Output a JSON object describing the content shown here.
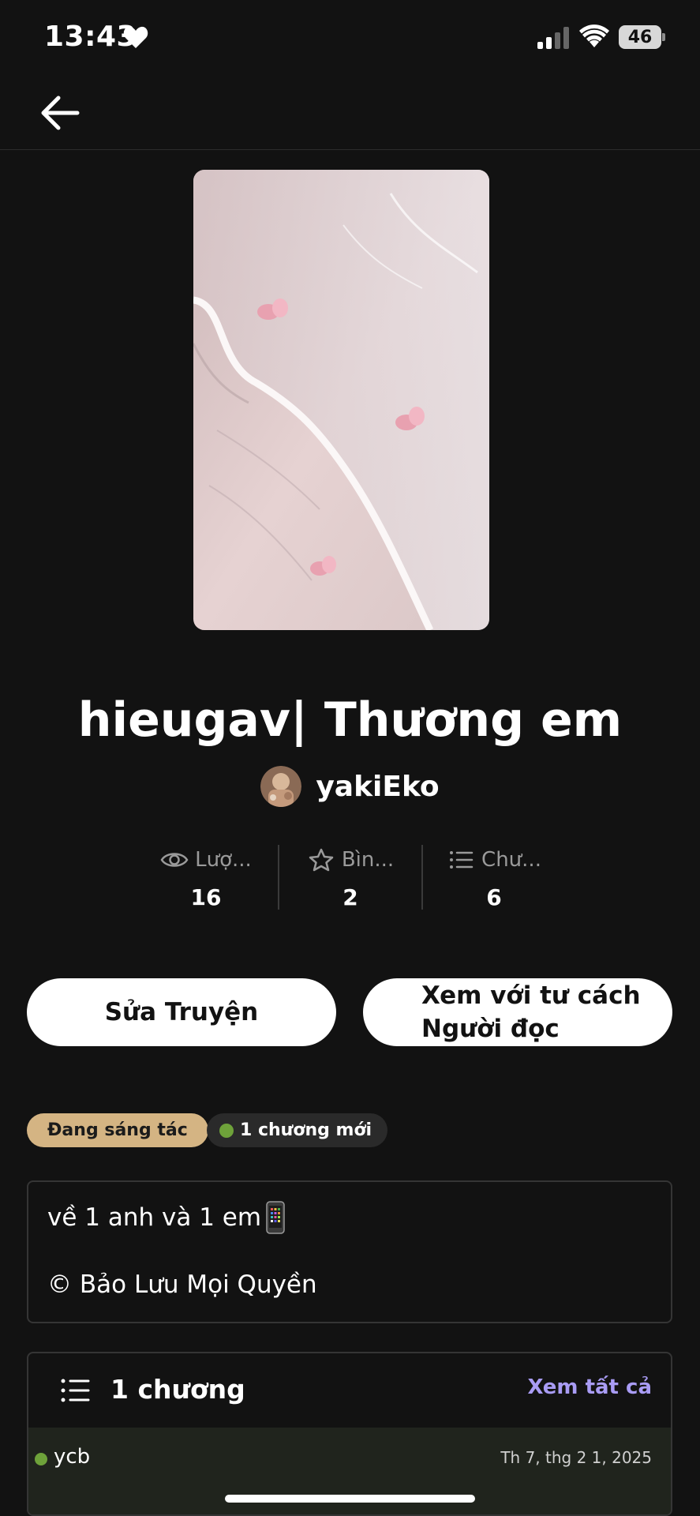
{
  "status_bar": {
    "time": "13:43",
    "battery": "46",
    "icons": [
      "heart-icon",
      "signal-icon",
      "wifi-icon",
      "battery-icon"
    ]
  },
  "nav": {
    "back_icon": "arrow-left-icon"
  },
  "story": {
    "title": "hieugav| Thương em",
    "author": "yakiEko"
  },
  "stats": [
    {
      "icon": "eye-icon",
      "label": "Lượ...",
      "value": "16"
    },
    {
      "icon": "star-icon",
      "label": "Bìn...",
      "value": "2"
    },
    {
      "icon": "list-icon",
      "label": "Chư...",
      "value": "6"
    }
  ],
  "actions": {
    "edit_label": "Sửa Truyện",
    "reader_label_line1": "Xem với tư cách",
    "reader_label_line2": "Người đọc"
  },
  "tags": {
    "status": "Đang sáng tác",
    "new_chapters": "1 chương mới"
  },
  "description": {
    "line1": "về 1 anh và 1 em",
    "line2": "© Bảo Lưu Mọi Quyền"
  },
  "chapters": {
    "count_label": "1 chương",
    "see_all": "Xem tất cả",
    "items": [
      {
        "name": "ycb",
        "date": "Th 7, thg 2 1, 2025"
      }
    ]
  },
  "colors": {
    "background": "#121212",
    "status_tag": "#d4b483",
    "accent_link": "#a99cf5",
    "new_dot": "#6ea23a"
  }
}
